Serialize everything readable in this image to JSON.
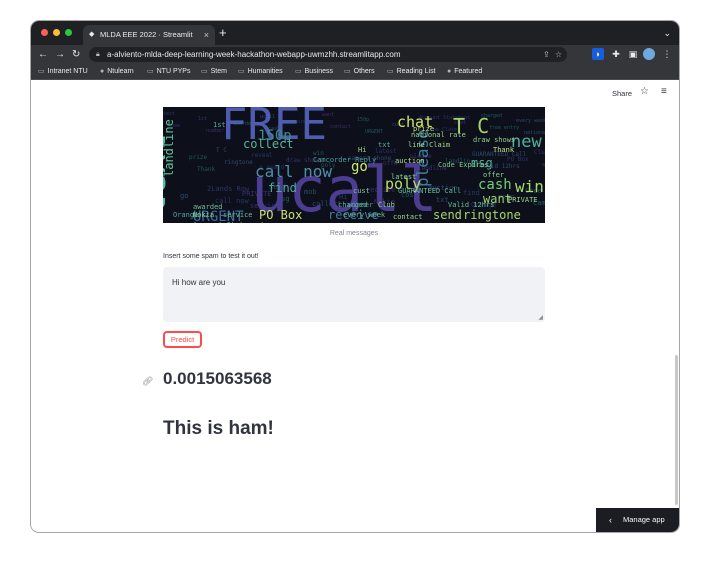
{
  "browser": {
    "tab_title": "MLDA EEE 2022 · Streamlit",
    "tab_close": "×",
    "new_tab": "+",
    "tab_menu": "⌄",
    "url": "a-alviento-mlda-deep-learning-week-hackathon-webapp-uwmzhh.streamlitapp.com",
    "bookmarks": [
      "Intranet NTU",
      "Ntulearn",
      "NTU PYPs",
      "Stem",
      "Humanities",
      "Business",
      "Others",
      "Reading List",
      "Featured"
    ]
  },
  "streamlit": {
    "share": "Share",
    "wordcloud_caption": "Real messages",
    "input_label": "Insert some spam to test it out!",
    "input_value": "Hi how are you",
    "predict_button": "Predict",
    "score": "0.0015063568",
    "verdict": "This is ham!",
    "manage_app": "Manage app",
    "wordcloud_words": [
      "text",
      "FREE",
      "ucall",
      "call now",
      "150p",
      "collect",
      "chat",
      "T C",
      "new",
      "win",
      "cash",
      "please",
      "URGENT",
      "PO Box",
      "send",
      "ringtone",
      "receive",
      "poly",
      "find",
      "landline",
      "go",
      "want",
      "msg",
      "Account Statement",
      "Nokia",
      "every week",
      "Orange",
      "awarded",
      "latest",
      "contact",
      "GUARANTEED Call",
      "line Claim",
      "prize",
      "national rate",
      "draw shows",
      "auction",
      "offer",
      "Code Expires",
      "Valid 12hrs",
      "PRIVATE",
      "Thank",
      "Hi",
      "charged",
      "txt",
      "1st",
      "Camcorder Reply",
      "winner",
      "service",
      "cust",
      "Club",
      "free entry",
      "reveal",
      "number",
      "camera phone",
      "game",
      "landlin",
      "2Lands Row",
      "won",
      "mob",
      "a award",
      "cost"
    ]
  },
  "colors": {
    "accent": "#ff4b4b",
    "text": "#31333f",
    "wordcloud_bg": "#0d0f1a"
  }
}
